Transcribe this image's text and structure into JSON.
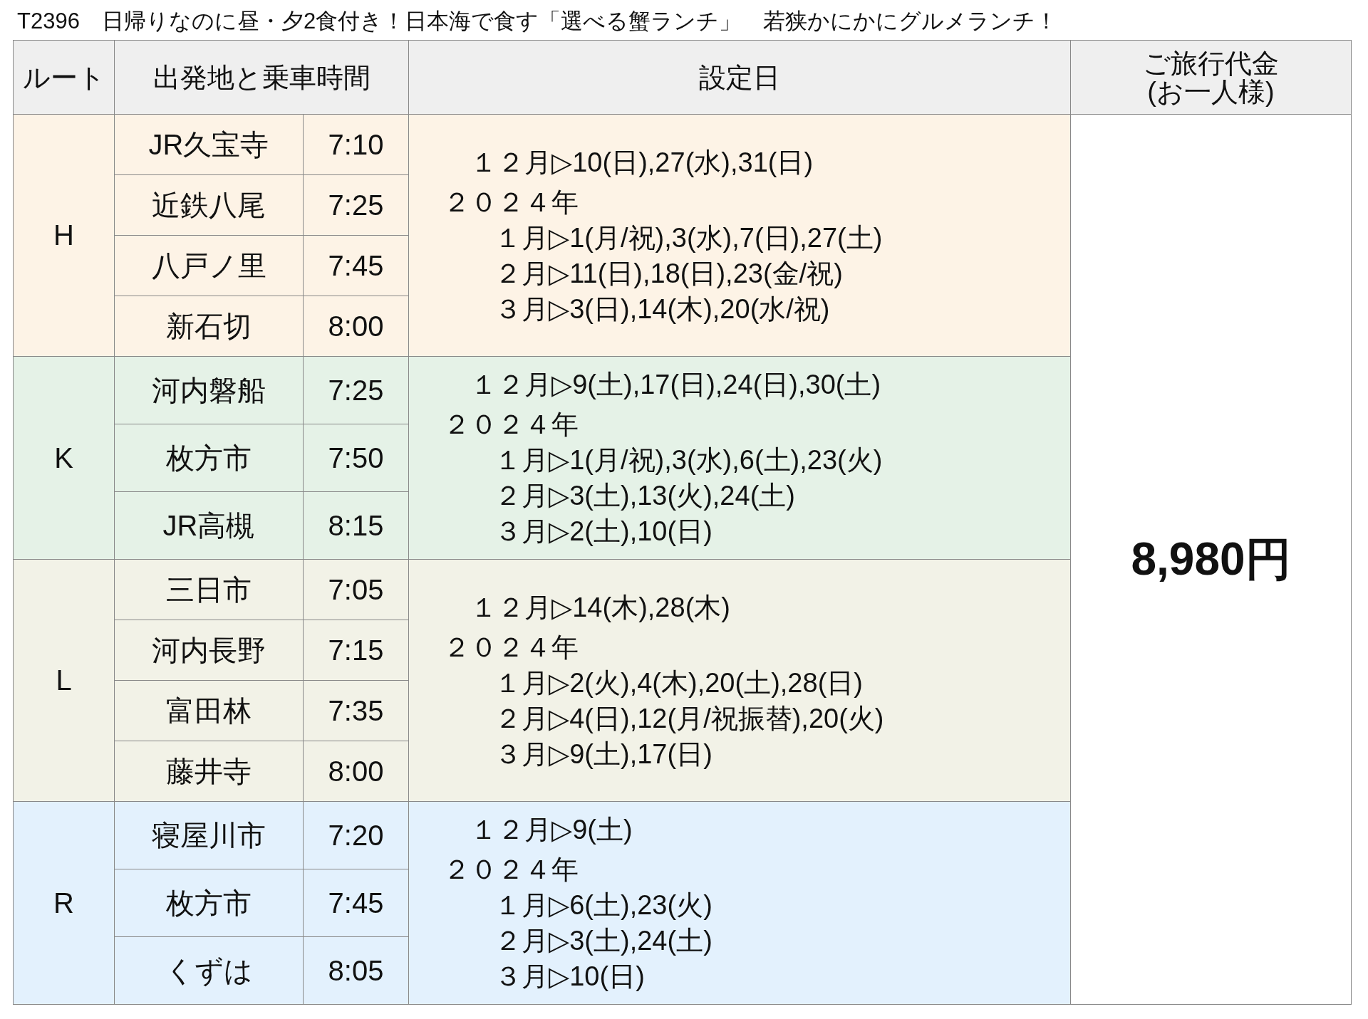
{
  "title": "T2396　日帰りなのに昼・夕2食付き！日本海で食す「選べる蟹ランチ」　若狭かにかにグルメランチ！",
  "table": {
    "columns": [
      "ルート",
      "出発地と乗車時間",
      "設定日",
      "ご旅行代金\n(お一人様)"
    ],
    "price": "8,980円",
    "groups": [
      {
        "route": "H",
        "color": "#fdf3e6",
        "stops": [
          {
            "station": "JR久宝寺",
            "time": "7:10"
          },
          {
            "station": "近鉄八尾",
            "time": "7:25"
          },
          {
            "station": "八戸ノ里",
            "time": "7:45"
          },
          {
            "station": "新石切",
            "time": "8:00"
          }
        ],
        "dates": [
          {
            "kind": "lead",
            "text": "１２月▷10(日),27(水),31(日)"
          },
          {
            "kind": "year",
            "text": "２０２４年"
          },
          {
            "kind": "month",
            "text": "１月▷1(月/祝),3(水),7(日),27(土)"
          },
          {
            "kind": "month",
            "text": "２月▷11(日),18(日),23(金/祝)"
          },
          {
            "kind": "month",
            "text": "３月▷3(日),14(木),20(水/祝)"
          }
        ]
      },
      {
        "route": "K",
        "color": "#e5f2e7",
        "stops": [
          {
            "station": "河内磐船",
            "time": "7:25"
          },
          {
            "station": "枚方市",
            "time": "7:50"
          },
          {
            "station": "JR高槻",
            "time": "8:15"
          }
        ],
        "dates": [
          {
            "kind": "lead",
            "text": "１２月▷9(土),17(日),24(日),30(土)"
          },
          {
            "kind": "year",
            "text": "２０２４年"
          },
          {
            "kind": "month",
            "text": "１月▷1(月/祝),3(水),6(土),23(火)"
          },
          {
            "kind": "month",
            "text": "２月▷3(土),13(火),24(土)"
          },
          {
            "kind": "month",
            "text": "３月▷2(土),10(日)"
          }
        ]
      },
      {
        "route": "L",
        "color": "#f2f2e7",
        "stops": [
          {
            "station": "三日市",
            "time": "7:05"
          },
          {
            "station": "河内長野",
            "time": "7:15"
          },
          {
            "station": "富田林",
            "time": "7:35"
          },
          {
            "station": "藤井寺",
            "time": "8:00"
          }
        ],
        "dates": [
          {
            "kind": "lead",
            "text": "１２月▷14(木),28(木)"
          },
          {
            "kind": "year",
            "text": "２０２４年"
          },
          {
            "kind": "month",
            "text": "１月▷2(火),4(木),20(土),28(日)"
          },
          {
            "kind": "month",
            "text": "２月▷4(日),12(月/祝振替),20(火)"
          },
          {
            "kind": "month",
            "text": "３月▷9(土),17(日)"
          }
        ]
      },
      {
        "route": "R",
        "color": "#e3f1fd",
        "stops": [
          {
            "station": "寝屋川市",
            "time": "7:20"
          },
          {
            "station": "枚方市",
            "time": "7:45"
          },
          {
            "station": "くずは",
            "time": "8:05"
          }
        ],
        "dates": [
          {
            "kind": "lead",
            "text": "１２月▷9(土)"
          },
          {
            "kind": "year",
            "text": "２０２４年"
          },
          {
            "kind": "month",
            "text": "１月▷6(土),23(火)"
          },
          {
            "kind": "month",
            "text": "２月▷3(土),24(土)"
          },
          {
            "kind": "month",
            "text": "３月▷10(日)"
          }
        ]
      }
    ]
  }
}
